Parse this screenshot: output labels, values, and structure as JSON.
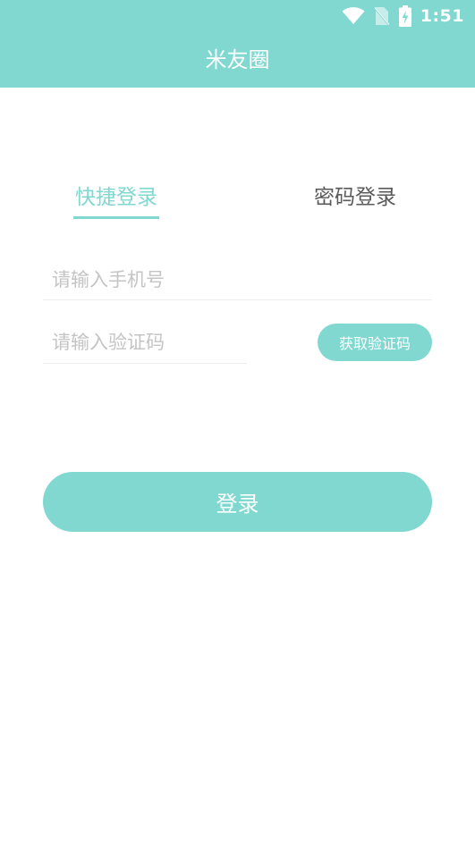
{
  "status_bar": {
    "time": "1:51",
    "icons": [
      "wifi-icon",
      "no-sim-icon",
      "battery-charging-icon"
    ]
  },
  "app": {
    "title": "米友圈",
    "accent_color": "#80d8d0"
  },
  "tabs": [
    {
      "label": "快捷登录",
      "active": true
    },
    {
      "label": "密码登录",
      "active": false
    }
  ],
  "form": {
    "phone": {
      "value": "",
      "placeholder": "请输入手机号"
    },
    "code": {
      "value": "",
      "placeholder": "请输入验证码"
    },
    "get_code_label": "获取验证码",
    "login_label": "登录"
  }
}
